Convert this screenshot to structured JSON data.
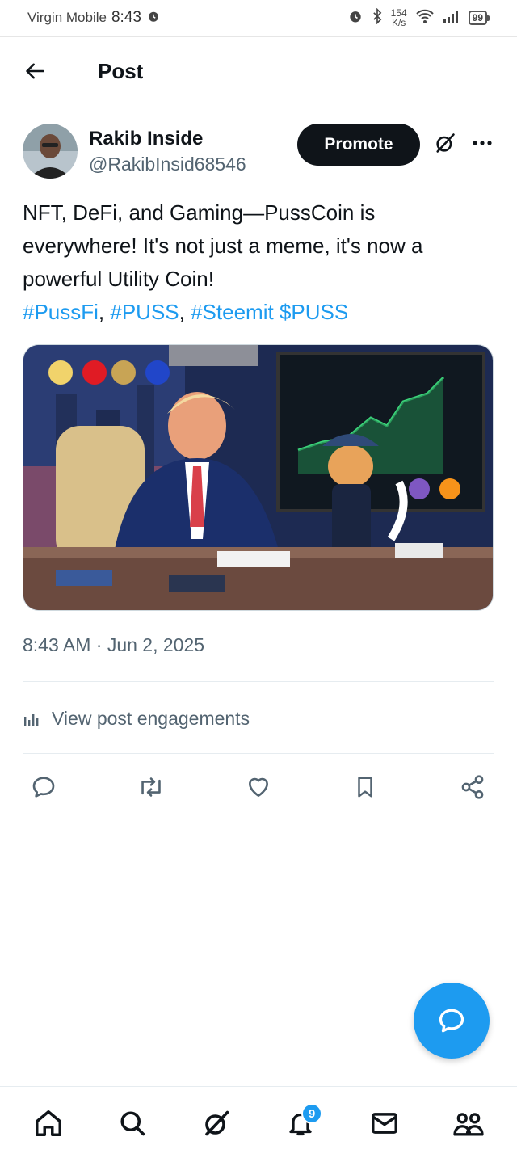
{
  "status_bar": {
    "carrier": "Virgin Mobile",
    "time": "8:43",
    "net_speed_value": "154",
    "net_speed_unit": "K/s",
    "battery": "99"
  },
  "header": {
    "title": "Post"
  },
  "post": {
    "author_name": "Rakib Inside",
    "author_handle": "@RakibInsid68546",
    "promote_label": "Promote",
    "text_line": "NFT, DeFi, and Gaming—PussCoin is everywhere! It's not just a meme, it's now a powerful Utility Coin!",
    "hashtags": [
      "#PussFi",
      "#PUSS",
      "#Steemit"
    ],
    "cashtag": "$PUSS",
    "separator": ", ",
    "timestamp": "8:43 AM · Jun 2, 2025",
    "engagements_label": "View post engagements"
  },
  "bottom_nav": {
    "notifications_badge": "9"
  },
  "colors": {
    "accent": "#1d9bf0",
    "text_primary": "#0f1419",
    "text_secondary": "#536471"
  }
}
